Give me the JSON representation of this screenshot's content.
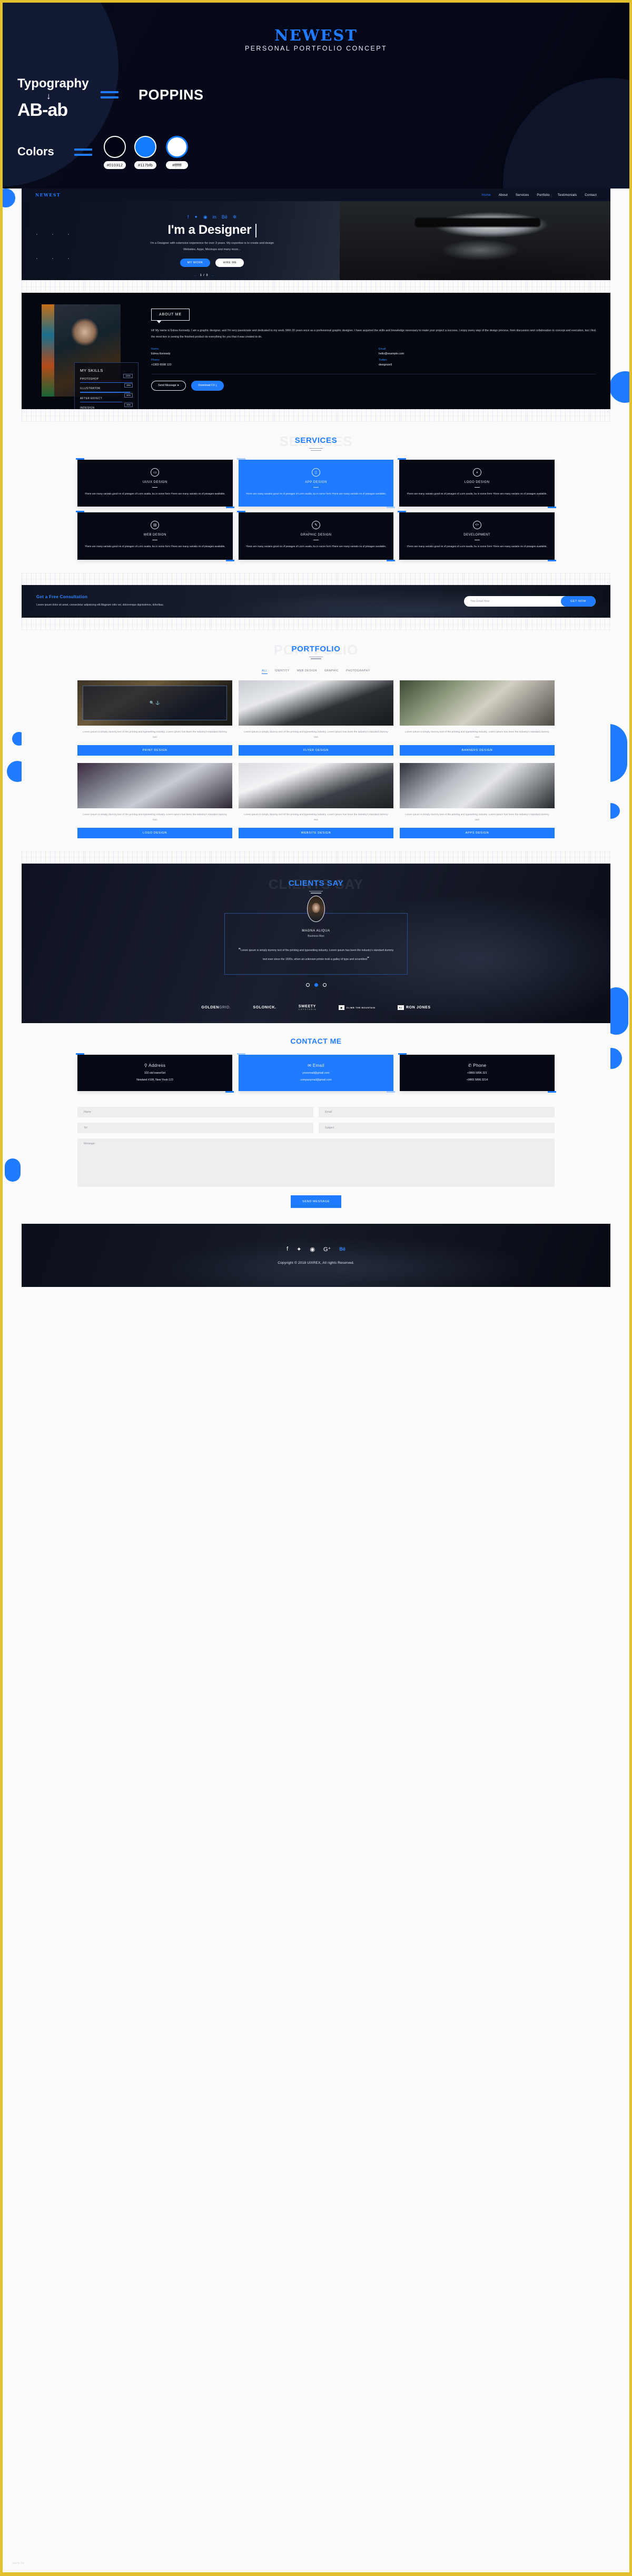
{
  "frame": {
    "accent_color": "#e3c02e"
  },
  "banner": {
    "brand": "NEWEST",
    "subtitle": "PERSONAL PORTFOLIO CONCEPT",
    "typography_label": "Typography",
    "typography_arrow": "↓",
    "typography_sample": "AB-ab",
    "typeface_name": "POPPINS",
    "colors_label": "Colors",
    "swatches": [
      {
        "name": "dark-swatch",
        "code": "#010312"
      },
      {
        "name": "blue-swatch",
        "code": "#117bfb"
      },
      {
        "name": "white-swatch",
        "code": "#ffffff"
      }
    ]
  },
  "site": {
    "nav": {
      "logo": "NEWEST",
      "links": [
        {
          "label": "Home",
          "active": true
        },
        {
          "label": "About",
          "active": false
        },
        {
          "label": "Services",
          "active": false
        },
        {
          "label": "Portfolio",
          "active": false
        },
        {
          "label": "Testimonials",
          "active": false
        },
        {
          "label": "Contact",
          "active": false
        }
      ]
    },
    "hero": {
      "social": [
        "facebook-icon",
        "twitter-icon",
        "instagram-icon",
        "linkedin-icon",
        "behance-icon",
        "dribbble-icon"
      ],
      "heading": "I'm a Designer",
      "paragraph": "I'm a Designer with extensive experience for over 3 years. My expertise is to create and design Websites, Apps, Mockups and many more...",
      "primary_button": "MY WORK",
      "secondary_button": "HIRE ME",
      "slide_counter": "1 / 3",
      "prev_arrow": "←",
      "next_arrow": "→"
    },
    "about": {
      "badge": "ABOUT ME",
      "text": "Hi! My name is Edrea Kennedy. I am a graphic designer, and I'm very passionate and dedicated to my work. With 20 years ence as a professional graphic designer, I have acquired the skills and knowledge necessary to make your project a success. I enjoy every step of the design process, from discussion and collaboration to concept and execution, but I find the most tion in seeing the finished product do everything for you that it was created to do.",
      "info": [
        {
          "label": "Name:",
          "value": "Edrea Kennedy"
        },
        {
          "label": "Email:",
          "value": "hello@example.com"
        },
        {
          "label": "Phone:",
          "value": "+1903 6598 123"
        },
        {
          "label": "Twitter",
          "value": "designuix9"
        }
      ],
      "send_button": "Send Message",
      "download_button": "Download CV",
      "skills_title": "MY SKILLS",
      "skills": [
        {
          "name": "PHOTOSHOP",
          "percent": "100%",
          "value": 100
        },
        {
          "name": "ILLUSTRATOR",
          "percent": "95%",
          "value": 95
        },
        {
          "name": "AFTER EFFECT",
          "percent": "80%",
          "value": 80
        },
        {
          "name": "INDESIGN",
          "percent": "90%",
          "value": 90
        }
      ]
    },
    "services": {
      "title": "SERVICES",
      "ghost_title": "SERVICES",
      "items": [
        {
          "icon": "monitor-icon",
          "glyph": "▭",
          "name": "UI/UX DESIGN",
          "desc": "There are many variatio good ns of pssages of Lorm availa, bu in some form There are many variatio ns of pssages available,",
          "active": false
        },
        {
          "icon": "mobile-icon",
          "glyph": "▮",
          "name": "APP DESIGN",
          "desc": "There are many variatio good ns of pssages of Lorm availa, bu in some form There are many variatio ns of pssages available,",
          "active": true
        },
        {
          "icon": "apple-icon",
          "glyph": "◗",
          "name": "LOGO DESIGN",
          "desc": "There are many variatio good ns of pssages of Lorm availa, bu in some form There are many variatio ns of pssages available,",
          "active": false
        },
        {
          "icon": "layers-icon",
          "glyph": "▤",
          "name": "WEB DESIGN",
          "desc": "There are many variatio good ns of pssages of Lorm availa, bu in some form There are many variatio ns of pssages available,",
          "active": false
        },
        {
          "icon": "pen-icon",
          "glyph": "✎",
          "name": "GRAPHIC DESIGN",
          "desc": "There are many variatio good ns of pssages of Lorm availa, bu in some form There are many variatio ns of pssages available,",
          "active": false
        },
        {
          "icon": "code-icon",
          "glyph": "</>",
          "name": "DEVELOPMENT",
          "desc": "There are many variatio good ns of pssages of Lorm availa, bu in some form There are many variatio ns of pssages available,",
          "active": false
        }
      ]
    },
    "consultation": {
      "heading": "Get a Free Consultation",
      "text": "Lorem ipsum dolor sit amet, consectetur adipisicing elit.Magnam odio vel, doloremque dignissimos, doloribus.",
      "placeholder": "Your Email Here",
      "button": "GET NOW"
    },
    "portfolio": {
      "title": "PORTFOLIO",
      "ghost_title": "PORTFOLIO",
      "filters": [
        {
          "label": "ALL",
          "active": true
        },
        {
          "label": "IDENTITY",
          "active": false
        },
        {
          "label": "WEB DESIGN",
          "active": false
        },
        {
          "label": "GRAPHIC",
          "active": false
        },
        {
          "label": "PHOTOGRAPHY",
          "active": false
        }
      ],
      "items": [
        {
          "desc": "Lorem ipsum is simply dummy text of the printing and typesetting industry. Lorem ipsum has been the industry's standard dummy text",
          "button": "PRINT DESIGN"
        },
        {
          "desc": "Lorem ipsum is simply dummy text of the printing and typesetting industry. Lorem ipsum has been the industry's standard dummy text",
          "button": "FLYER DESIGN"
        },
        {
          "desc": "Lorem ipsum is simply dummy text of the printing and typesetting industry. Lorem ipsum has been the industry's standard dummy text",
          "button": "BANNERS DESIGN"
        },
        {
          "desc": "Lorem ipsum is simply dummy text of the printing and typesetting industry. Lorem ipsum has been the industry's standard dummy text",
          "button": "LOGO DESIGN"
        },
        {
          "desc": "Lorem ipsum is simply dummy text of the printing and typesetting industry. Lorem ipsum has been the industry's standard dummy text",
          "button": "WEBSITE DESIGN"
        },
        {
          "desc": "Lorem ipsum is simply dummy text of the printing and typesetting industry. Lorem ipsum has been the industry's standard dummy text",
          "button": "APPS DESIGN"
        }
      ]
    },
    "testimonials": {
      "title": "CLIENTS SAY",
      "ghost_title": "CLIENTS SAY",
      "name": "MAGNA ALIQUA",
      "role": "Business Man",
      "quote": "Lorem ipsum is simply dummy text of the printing and typesetting industry. Lorem ipsum has been the industry's standard dummy text ever since the 1500s, when an unknown printer took a galley of type and scrambled",
      "open_quote": "“",
      "close_quote": "”",
      "dots": [
        false,
        true,
        false
      ],
      "clients": [
        {
          "bold": "GOLDEN",
          "light": "GRID."
        },
        {
          "bold": "SOLONICK.",
          "light": ""
        },
        {
          "bold": "SWEETY",
          "light": "",
          "sub": "CAFETERIA"
        },
        {
          "bold": "CLIMB THE MOUNTAIN",
          "light": "",
          "badge": "climb"
        },
        {
          "bold": "RON JONES",
          "light": "",
          "badge": "RJ"
        }
      ]
    },
    "contact": {
      "title": "CONTACT ME",
      "cards": [
        {
          "icon": "location-icon",
          "glyph": "📍",
          "head": "Address",
          "lines": [
            "102 old towneStrt",
            "Newland #106, New Yook-123"
          ],
          "active": false
        },
        {
          "icon": "envelope-icon",
          "glyph": "✉",
          "head": "Email",
          "lines": [
            "youremail@gmail.com",
            "companymail@gmail.com"
          ],
          "active": true
        },
        {
          "icon": "phone-icon",
          "glyph": "📞",
          "head": "Phone",
          "lines": [
            "+9865 5896 321",
            "+9865 5896 3214"
          ],
          "active": false
        }
      ],
      "fields": [
        {
          "name": "name-field",
          "placeholder": "Name"
        },
        {
          "name": "email-field",
          "placeholder": "Email"
        },
        {
          "name": "tel-field",
          "placeholder": "Tel"
        },
        {
          "name": "subject-field",
          "placeholder": "Subject"
        }
      ],
      "message_placeholder": "Message",
      "send_button": "SEND MESSAGE"
    },
    "footer": {
      "social": [
        "facebook-icon",
        "twitter-icon",
        "instagram-icon",
        "google-plus-icon",
        "behance-icon"
      ],
      "copyright": "Copyright © 2018 UIXREX, All rights Reserved."
    }
  },
  "watermark": {
    "faded": "www.bc",
    "text": "hristiancollege.com"
  }
}
